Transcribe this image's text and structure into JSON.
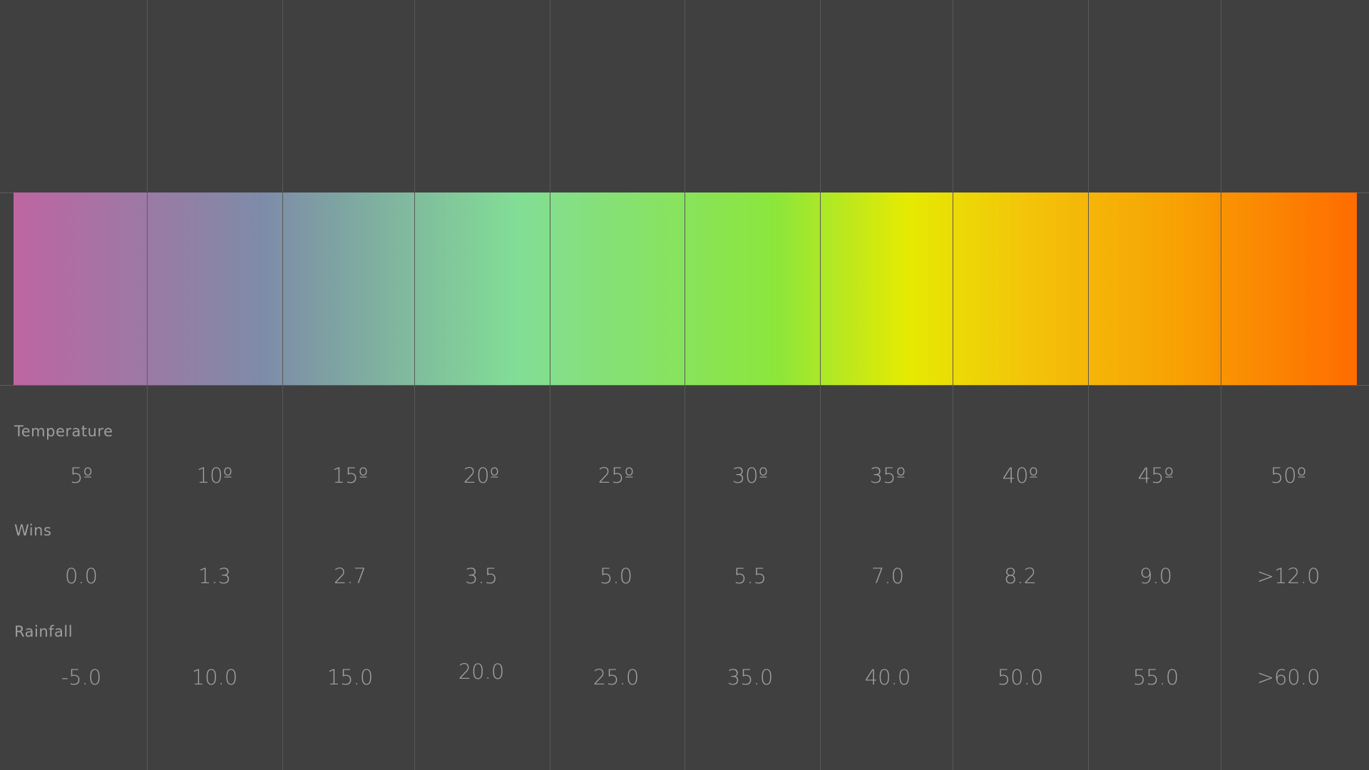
{
  "legend": {
    "colors": [
      "#be65a2",
      "#7d8ca8",
      "#82de95",
      "#8be63c",
      "#e6ea02",
      "#f3c30a",
      "#f7a504",
      "#ff6c00"
    ],
    "rows": [
      {
        "label": "Temperature",
        "values": [
          "5º",
          "10º",
          "15º",
          "20º",
          "25º",
          "30º",
          "35º",
          "40º",
          "45º",
          "50º"
        ]
      },
      {
        "label": "Wins",
        "values": [
          "0.0",
          "1.3",
          "2.7",
          "3.5",
          "5.0",
          "5.5",
          "7.0",
          "8.2",
          "9.0",
          ">12.0"
        ]
      },
      {
        "label": "Rainfall",
        "values": [
          "-5.0",
          "10.0",
          "15.0",
          "20.0",
          "25.0",
          "35.0",
          "40.0",
          "50.0",
          "55.0",
          ">60.0"
        ]
      }
    ]
  }
}
